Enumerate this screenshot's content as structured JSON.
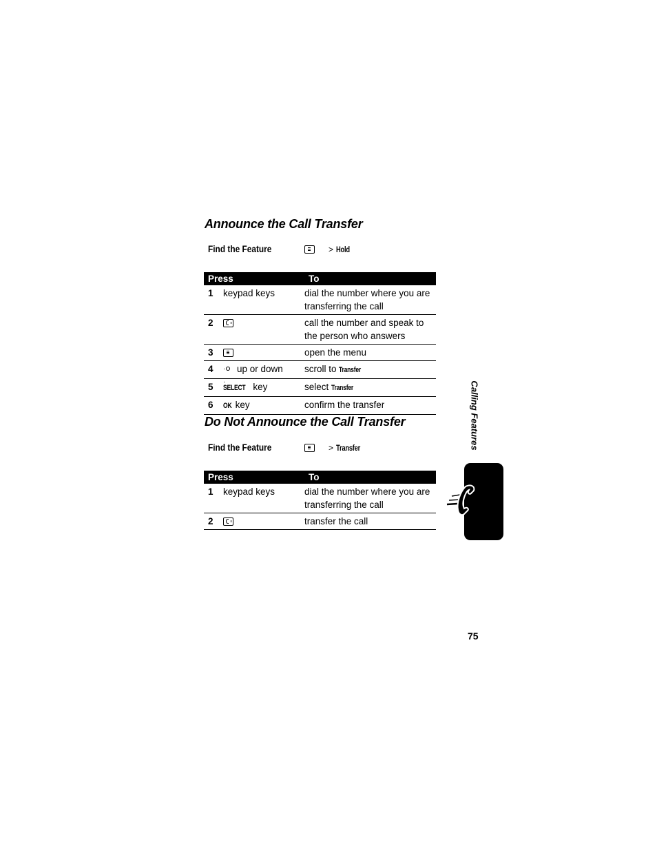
{
  "section1": {
    "title": "Announce the Call Transfer",
    "find_feature": {
      "label": "Find the Feature",
      "icon": "menu-key-icon",
      "separator": ">",
      "path": "Hold"
    },
    "table": {
      "headers": [
        "Press",
        "To"
      ],
      "rows": [
        {
          "num": "1",
          "press_text": "keypad keys",
          "to": "dial the number where you are transferring the call"
        },
        {
          "num": "2",
          "press_icon": "send-key-icon",
          "to": "call the number and speak to the person who answers"
        },
        {
          "num": "3",
          "press_icon": "menu-key-icon",
          "to": "open the menu"
        },
        {
          "num": "4",
          "press_icon": "nav-key-icon",
          "press_text": "up or down",
          "to_text": "scroll to",
          "to_keyword": "Transfer"
        },
        {
          "num": "5",
          "press_keyword": "SELECT",
          "press_text": "key",
          "to_text": "select",
          "to_keyword": "Transfer"
        },
        {
          "num": "6",
          "press_keyword": "OK",
          "press_text": "key",
          "to": "confirm the transfer"
        }
      ]
    }
  },
  "section2": {
    "title": "Do Not Announce the Call Transfer",
    "find_feature": {
      "label": "Find the Feature",
      "icon": "menu-key-icon",
      "separator": ">",
      "path": "Transfer"
    },
    "table": {
      "headers": [
        "Press",
        "To"
      ],
      "rows": [
        {
          "num": "1",
          "press_text": "keypad keys",
          "to": "dial the number where you are transferring the call"
        },
        {
          "num": "2",
          "press_icon": "send-key-icon",
          "to": "transfer the call"
        }
      ]
    }
  },
  "side_tab": {
    "label": "Calling Features",
    "icon": "phone-handset-icon"
  },
  "page_number": "75"
}
